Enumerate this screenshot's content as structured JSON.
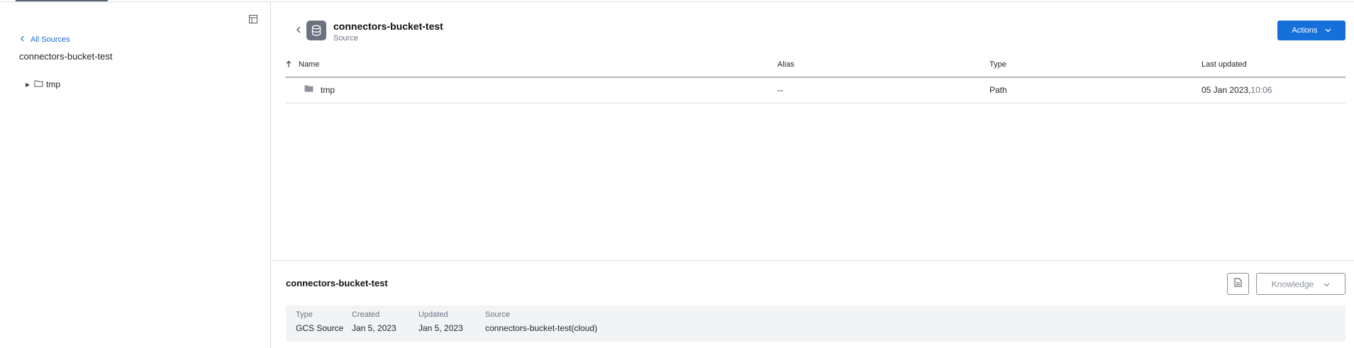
{
  "sidebar": {
    "back_label": "All Sources",
    "title": "connectors-bucket-test",
    "tree": [
      {
        "label": "tmp"
      }
    ]
  },
  "header": {
    "title": "connectors-bucket-test",
    "subtitle": "Source",
    "actions_label": "Actions"
  },
  "table": {
    "columns": [
      "Name",
      "Alias",
      "Type",
      "Last updated"
    ],
    "rows": [
      {
        "name": "tmp",
        "alias": "--",
        "type": "Path",
        "date": "05 Jan 2023,",
        "time": "10:06"
      }
    ]
  },
  "details": {
    "title": "connectors-bucket-test",
    "knowledge_label": "Knowledge",
    "fields": [
      {
        "label": "Type",
        "value": "GCS Source"
      },
      {
        "label": "Created",
        "value": "Jan 5, 2023"
      },
      {
        "label": "Updated",
        "value": "Jan 5, 2023"
      },
      {
        "label": "Source",
        "value": "connectors-bucket-test(cloud)"
      }
    ]
  },
  "colors": {
    "accent": "#1670d9",
    "link": "#1a6fd6",
    "icon_gray": "#6b7280"
  }
}
